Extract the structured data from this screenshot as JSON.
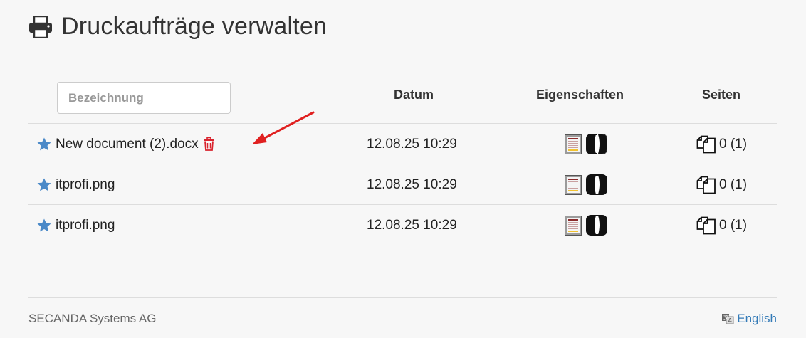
{
  "header": {
    "title": "Druckaufträge verwalten",
    "icon": "printer-icon"
  },
  "table": {
    "filter": {
      "placeholder": "Bezeichnung",
      "value": ""
    },
    "columns": {
      "date": "Datum",
      "properties": "Eigenschaften",
      "pages": "Seiten"
    },
    "rows": [
      {
        "name": "New document (2).docx",
        "date": "12.08.25 10:29",
        "pages": "0 (1)",
        "has_delete": true
      },
      {
        "name": "itprofi.png",
        "date": "12.08.25 10:29",
        "pages": "0 (1)",
        "has_delete": false
      },
      {
        "name": "itprofi.png",
        "date": "12.08.25 10:29",
        "pages": "0 (1)",
        "has_delete": false
      }
    ]
  },
  "icons": {
    "star": "star-icon",
    "delete": "trash-icon",
    "properties_paper": "document-icon",
    "properties_color": "contrast-icon",
    "pages": "copy-icon",
    "language": "language-icon"
  },
  "colors": {
    "star": "#4a89c8",
    "delete": "#d9232d",
    "arrow": "#e02020",
    "link": "#337ab7",
    "background": "#f7f7f7"
  },
  "footer": {
    "company": "SECANDA Systems AG",
    "language_link": "English"
  }
}
